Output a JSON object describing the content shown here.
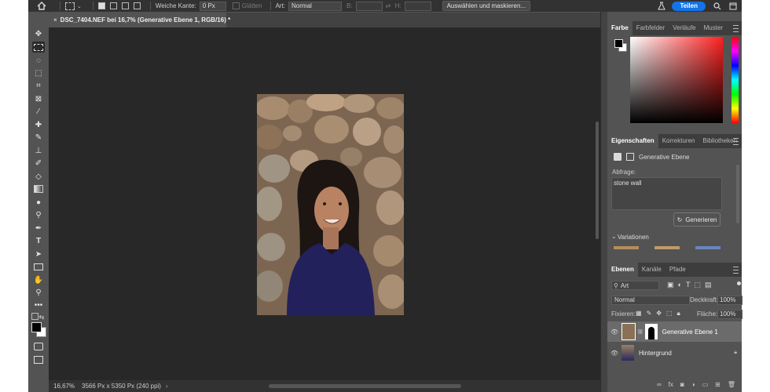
{
  "options_bar": {
    "feather_label": "Weiche Kante:",
    "feather_value": "0 Px",
    "antialias_label": "Glätten",
    "style_label": "Art:",
    "style_value": "Normal",
    "width_label": "B:",
    "height_label": "H:",
    "select_mask_button": "Auswählen und maskieren...",
    "share_button": "Teilen"
  },
  "document_tab": {
    "close_glyph": "×",
    "title": "DSC_7404.NEF bei 16,7% (Generative Ebene 1, RGB/16) *"
  },
  "status_bar": {
    "zoom": "16,67%",
    "doc_info": "3566 Px x 5350 Px (240 ppi)"
  },
  "color_panel": {
    "tabs": [
      "Farbe",
      "Farbfelder",
      "Verläufe",
      "Muster"
    ],
    "colors": {
      "foreground": "#000000",
      "background": "#ffffff"
    }
  },
  "properties_panel": {
    "tabs": [
      "Eigenschaften",
      "Korrekturen",
      "Bibliotheken"
    ],
    "layer_type": "Generative Ebene",
    "prompt_label": "Abfrage:",
    "prompt_value": "stone wall",
    "generate_button": "Generieren",
    "variations_label": "Variationen"
  },
  "layers_panel": {
    "tabs": [
      "Ebenen",
      "Kanäle",
      "Pfade"
    ],
    "filter_kind": "Art",
    "blend_mode": "Normal",
    "opacity_label": "Deckkraft:",
    "opacity_value": "100%",
    "lock_label": "Fixieren:",
    "fill_label": "Fläche:",
    "fill_value": "100%",
    "layers": [
      {
        "name": "Generative Ebene 1",
        "selected": true
      },
      {
        "name": "Hintergrund",
        "selected": false
      }
    ]
  },
  "accent_color": "#1473e6"
}
